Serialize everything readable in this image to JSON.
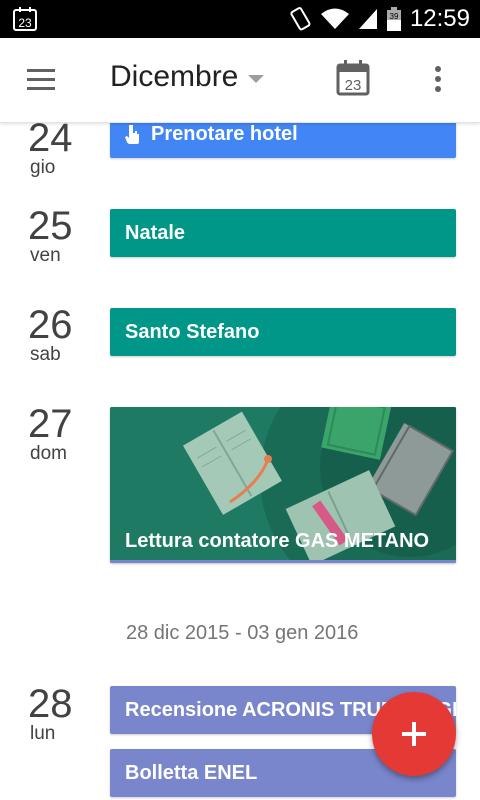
{
  "status_bar": {
    "calendar_day": "23",
    "battery": "39",
    "time": "12:59"
  },
  "toolbar": {
    "month": "Dicembre",
    "today_day": "23"
  },
  "days": [
    {
      "num": "24",
      "name": "gio",
      "events": [
        {
          "title": "Prenotare hotel",
          "color": "#4285f4",
          "icon": "hand-pointer-icon"
        }
      ]
    },
    {
      "num": "25",
      "name": "ven",
      "events": [
        {
          "title": "Natale",
          "color": "#009688"
        }
      ]
    },
    {
      "num": "26",
      "name": "sab",
      "events": [
        {
          "title": "Santo Stefano",
          "color": "#009688"
        }
      ]
    },
    {
      "num": "27",
      "name": "dom",
      "events": [
        {
          "title": "Lettura contatore GAS METANO",
          "color": "#1f7a63",
          "illustration": "books-illustration"
        }
      ]
    },
    {
      "num": "28",
      "name": "lun",
      "events": [
        {
          "title": "Recensione ACRONIS TRUE IMAGE",
          "color": "#7986cb"
        },
        {
          "title": "Bolletta ENEL",
          "color": "#7986cb"
        }
      ]
    }
  ],
  "week_separator": "28 dic 2015 - 03 gen 2016",
  "fab": {
    "icon": "plus-icon",
    "color": "#e53935"
  }
}
